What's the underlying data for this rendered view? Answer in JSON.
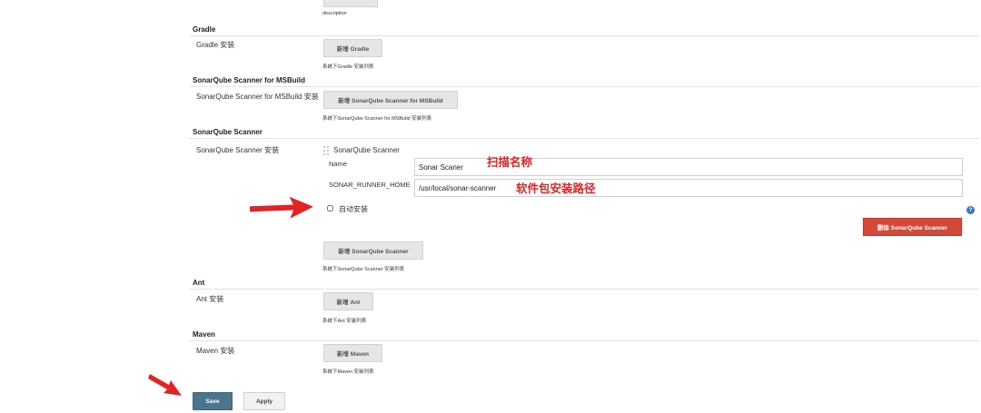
{
  "top": {
    "hint": "description"
  },
  "gradle": {
    "title": "Gradle",
    "row_label": "Gradle 安装",
    "add_button": "新增 Gradle",
    "hint": "系统下Gradle 安装列表"
  },
  "msbuild": {
    "title": "SonarQube Scanner for MSBuild",
    "row_label": "SonarQube Scanner for MSBuild 安装",
    "add_button": "新增 SonarQube Scanner for MSBuild",
    "hint": "系统下SonarQube Scanner for MSBuild 安装列表"
  },
  "sonar": {
    "title": "SonarQube Scanner",
    "row_label": "SonarQube Scanner 安装",
    "item_title": "SonarQube Scanner",
    "name_label": "Name",
    "name_value": "Sonar Scaner",
    "home_label": "SONAR_RUNNER_HOME",
    "home_value": "/usr/local/sonar-scanner",
    "auto_install_label": "自动安装",
    "delete_button": "删除 SonarQube Scanner",
    "add_button": "新增 SonarQube Scanner",
    "hint": "系统下SonarQube Scanner 安装列表",
    "annotations": {
      "name": "扫描名称",
      "home": "软件包安装路径"
    }
  },
  "ant": {
    "title": "Ant",
    "row_label": "Ant 安装",
    "add_button": "新增 Ant",
    "hint": "系统下Ant 安装列表"
  },
  "maven": {
    "title": "Maven",
    "row_label": "Maven 安装",
    "add_button": "新增 Maven",
    "hint": "系统下Maven 安装列表"
  },
  "footer": {
    "save_label": "Save",
    "apply_label": "Apply"
  },
  "icons": {
    "help": "question-icon",
    "drag": "drag-handle-icon",
    "arrow": "red-arrow-annotation"
  },
  "colors": {
    "save": "#4b758b",
    "danger": "#d24939",
    "annotation": "#e32222"
  }
}
